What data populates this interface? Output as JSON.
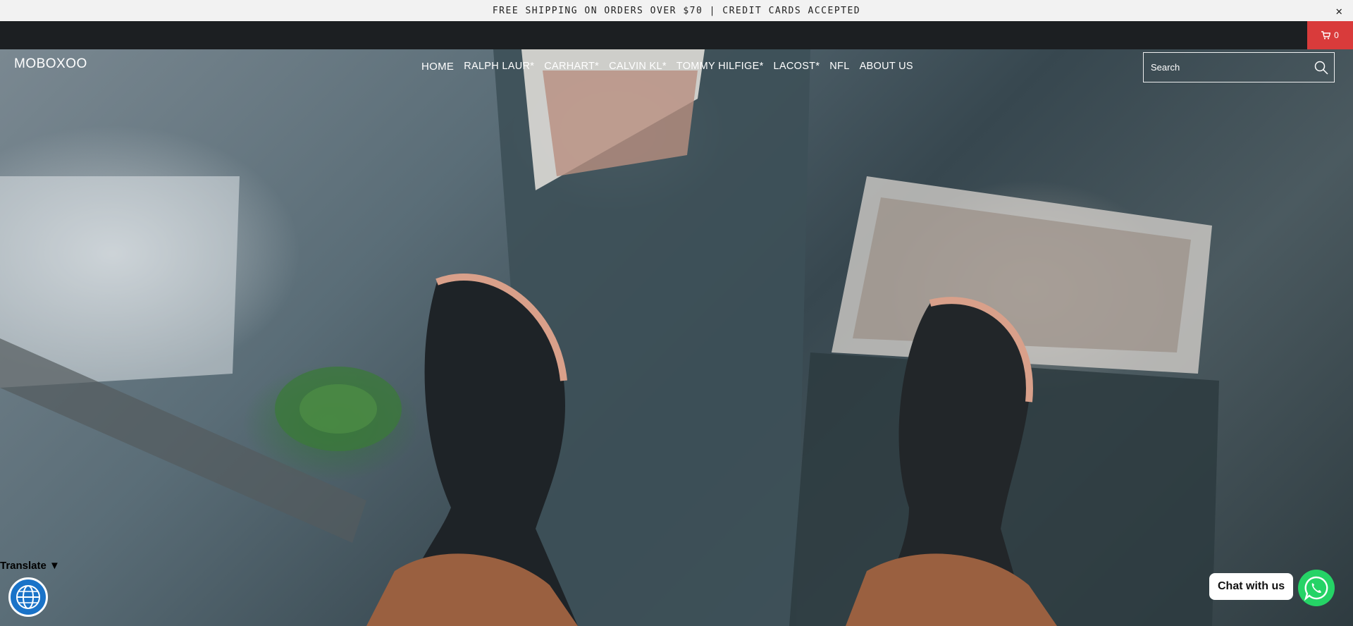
{
  "announcement": {
    "text": "FREE SHIPPING ON ORDERS OVER $70 | CREDIT CARDS ACCEPTED",
    "close_icon": "close-icon"
  },
  "cart": {
    "icon": "cart-icon",
    "count": "0",
    "color": "#d93b3b"
  },
  "header": {
    "logo": "MOBOXOO",
    "nav": [
      {
        "label": "HOME",
        "active": true
      },
      {
        "label": "RALPH LAUR*"
      },
      {
        "label": "CARHART*"
      },
      {
        "label": "CALVIN KL*"
      },
      {
        "label": "TOMMY HILFIGE*"
      },
      {
        "label": "LACOST*"
      },
      {
        "label": "NFL"
      },
      {
        "label": "ABOUT US"
      }
    ],
    "search": {
      "placeholder": "Search",
      "icon": "search-icon"
    }
  },
  "widgets": {
    "translate_label": "Translate ▼",
    "globe_icon": "globe-icon",
    "chat_label": "Chat with us",
    "whatsapp_icon": "whatsapp-icon",
    "whatsapp_color": "#25d366"
  }
}
